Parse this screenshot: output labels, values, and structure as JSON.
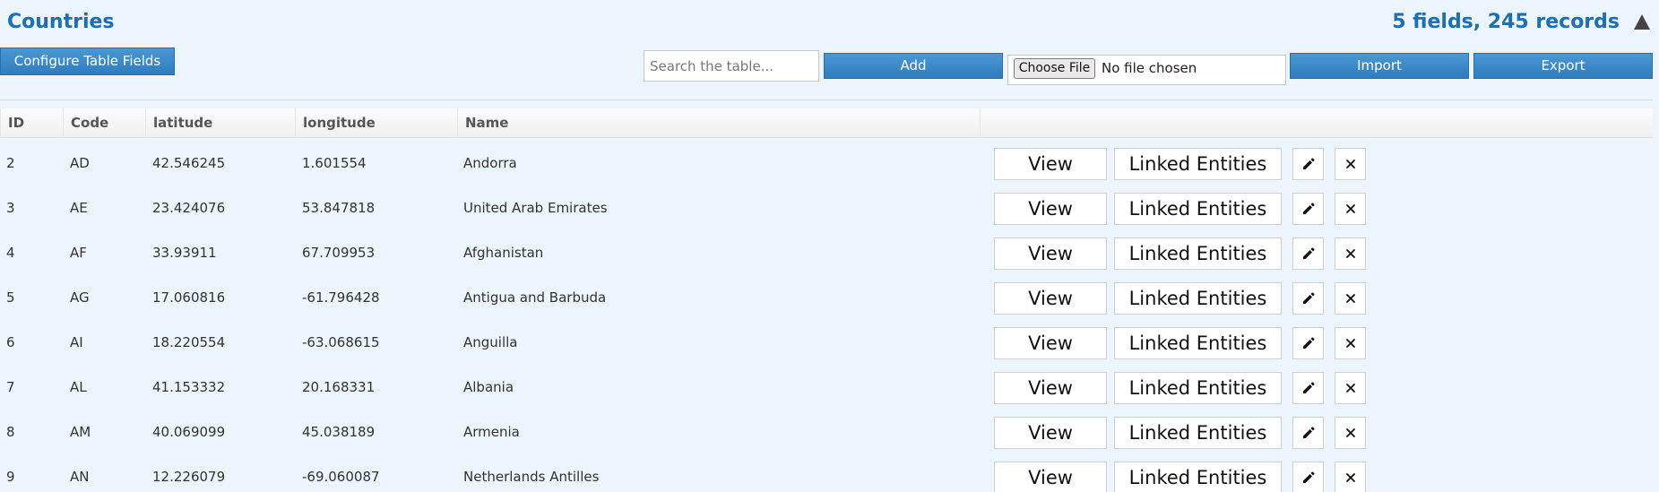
{
  "header": {
    "title": "Countries",
    "summary": "5 fields, 245 records"
  },
  "toolbar": {
    "configure_label": "Configure Table Fields",
    "search_placeholder": "Search the table...",
    "add_label": "Add",
    "choose_file_label": "Choose File",
    "no_file_text": "No file chosen",
    "import_label": "Import",
    "export_label": "Export"
  },
  "table": {
    "columns": [
      "ID",
      "Code",
      "latitude",
      "longitude",
      "Name"
    ],
    "action_labels": {
      "view": "View",
      "linked": "Linked Entities"
    },
    "rows": [
      {
        "id": "2",
        "code": "AD",
        "latitude": "42.546245",
        "longitude": "1.601554",
        "name": "Andorra"
      },
      {
        "id": "3",
        "code": "AE",
        "latitude": "23.424076",
        "longitude": "53.847818",
        "name": "United Arab Emirates"
      },
      {
        "id": "4",
        "code": "AF",
        "latitude": "33.93911",
        "longitude": "67.709953",
        "name": "Afghanistan"
      },
      {
        "id": "5",
        "code": "AG",
        "latitude": "17.060816",
        "longitude": "-61.796428",
        "name": "Antigua and Barbuda"
      },
      {
        "id": "6",
        "code": "AI",
        "latitude": "18.220554",
        "longitude": "-63.068615",
        "name": "Anguilla"
      },
      {
        "id": "7",
        "code": "AL",
        "latitude": "41.153332",
        "longitude": "20.168331",
        "name": "Albania"
      },
      {
        "id": "8",
        "code": "AM",
        "latitude": "40.069099",
        "longitude": "45.038189",
        "name": "Armenia"
      },
      {
        "id": "9",
        "code": "AN",
        "latitude": "12.226079",
        "longitude": "-69.060087",
        "name": "Netherlands Antilles"
      }
    ]
  },
  "icons": {
    "edit": "pencil-icon",
    "delete": "close-icon",
    "collapse": "triangle-up-icon"
  },
  "colors": {
    "background": "#ecf4fc",
    "accent": "#1a6fb5",
    "button": "#3585c6"
  }
}
